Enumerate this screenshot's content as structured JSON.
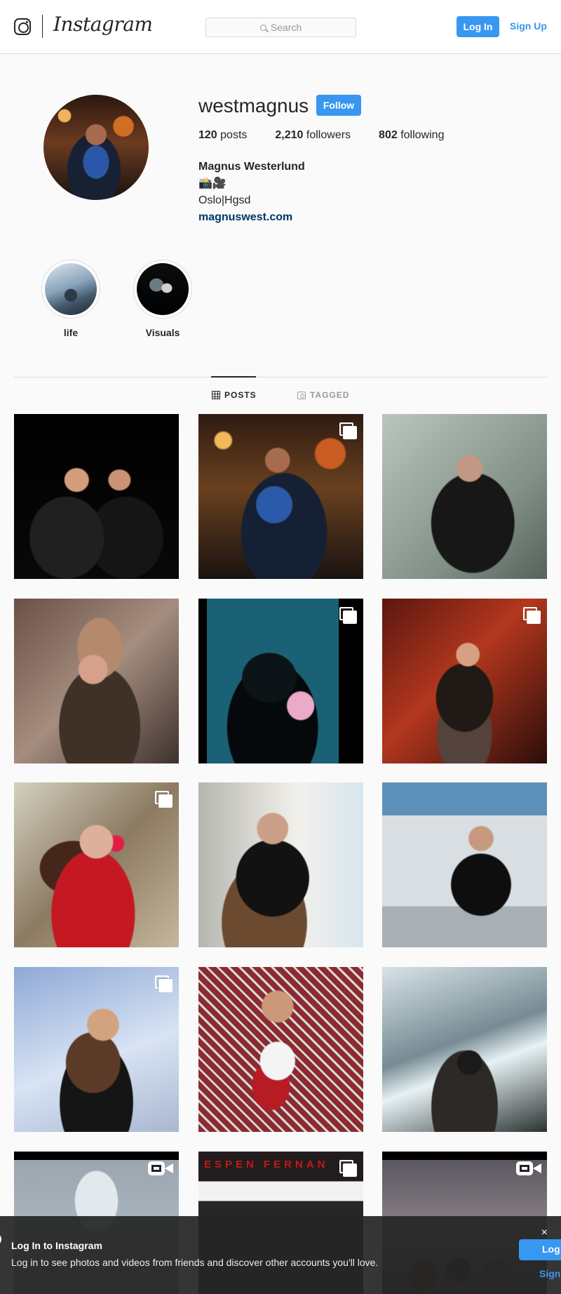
{
  "header": {
    "brand": "Instagram",
    "search_placeholder": "Search",
    "login_label": "Log In",
    "signup_label": "Sign Up"
  },
  "profile": {
    "username": "westmagnus",
    "follow_label": "Follow",
    "stats": [
      {
        "value": "120",
        "label": "posts"
      },
      {
        "value": "2,210",
        "label": "followers"
      },
      {
        "value": "802",
        "label": "following"
      }
    ],
    "full_name": "Magnus Westerlund",
    "emoji_line": "📸🎥",
    "location": "Oslo|Hgsd",
    "website": "magnuswest.com"
  },
  "highlights": [
    {
      "label": "life"
    },
    {
      "label": "Visuals"
    }
  ],
  "tabs": [
    {
      "label": "POSTS",
      "icon": "grid-icon",
      "active": true
    },
    {
      "label": "TAGGED",
      "icon": "tag-icon",
      "active": false
    }
  ],
  "posts": [
    {
      "badge": ""
    },
    {
      "badge": "multiple-posts-icon"
    },
    {
      "badge": ""
    },
    {
      "badge": ""
    },
    {
      "badge": "multiple-posts-icon"
    },
    {
      "badge": "multiple-posts-icon"
    },
    {
      "badge": "multiple-posts-icon"
    },
    {
      "badge": ""
    },
    {
      "badge": ""
    },
    {
      "badge": "multiple-posts-icon"
    },
    {
      "badge": ""
    },
    {
      "badge": ""
    },
    {
      "badge": "video-icon"
    },
    {
      "badge": "multiple-posts-icon",
      "text": "ESPEN FERNAN"
    },
    {
      "badge": "video-icon"
    }
  ],
  "banner": {
    "title": "Log In to Instagram",
    "message": "Log in to see photos and videos from friends and discover other accounts you'll love.",
    "close_icon": "close-icon",
    "login_label": "Log",
    "signup_label": "Sign"
  },
  "colors": {
    "accent": "#3897f0",
    "text": "#262626",
    "border": "#dbdbdb"
  }
}
